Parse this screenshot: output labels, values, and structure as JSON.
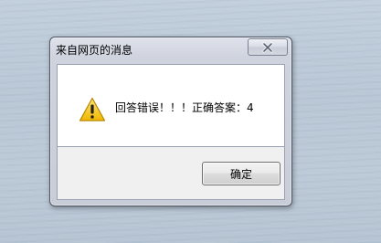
{
  "dialog": {
    "title": "来自网页的消息",
    "message": "回答错误！！！正确答案：4",
    "ok_label": "确定",
    "icon": "warning-icon",
    "close_icon": "close-icon"
  },
  "colors": {
    "warning_yellow": "#f5c518",
    "desktop_background": "#bccad8"
  }
}
